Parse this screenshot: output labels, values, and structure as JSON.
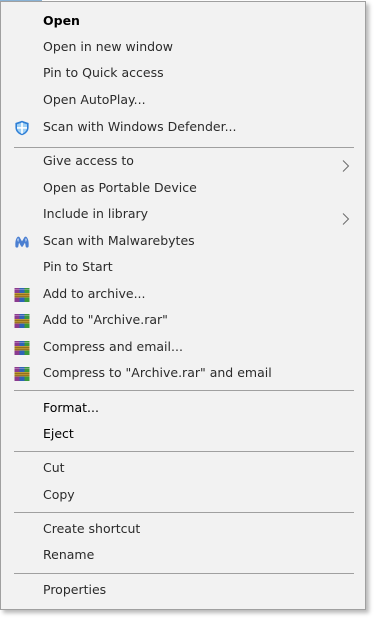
{
  "context_menu": {
    "items": {
      "open": "Open",
      "open_new_window": "Open in new window",
      "pin_quick_access": "Pin to Quick access",
      "open_autoplay": "Open AutoPlay...",
      "scan_defender": "Scan with Windows Defender...",
      "give_access": "Give access to",
      "open_portable": "Open as Portable Device",
      "include_library": "Include in library",
      "scan_malwarebytes": "Scan with Malwarebytes",
      "pin_start": "Pin to Start",
      "add_archive": "Add to archive...",
      "add_archive_rar": "Add to \"Archive.rar\"",
      "compress_email": "Compress and email...",
      "compress_rar_email": "Compress to \"Archive.rar\" and email",
      "format": "Format...",
      "eject": "Eject",
      "cut": "Cut",
      "copy": "Copy",
      "create_shortcut": "Create shortcut",
      "rename": "Rename",
      "properties": "Properties"
    },
    "icons": {
      "defender": "windows-defender-shield-icon",
      "malwarebytes": "malwarebytes-icon",
      "winrar": "winrar-books-icon",
      "submenu": "chevron-right-icon"
    },
    "colors": {
      "background": "#f2f2f2",
      "border": "#a0a0a0",
      "text": "#2b2b2b",
      "defender_blue": "#2f7fd6",
      "malwarebytes_blue": "#4b7fd1"
    }
  }
}
